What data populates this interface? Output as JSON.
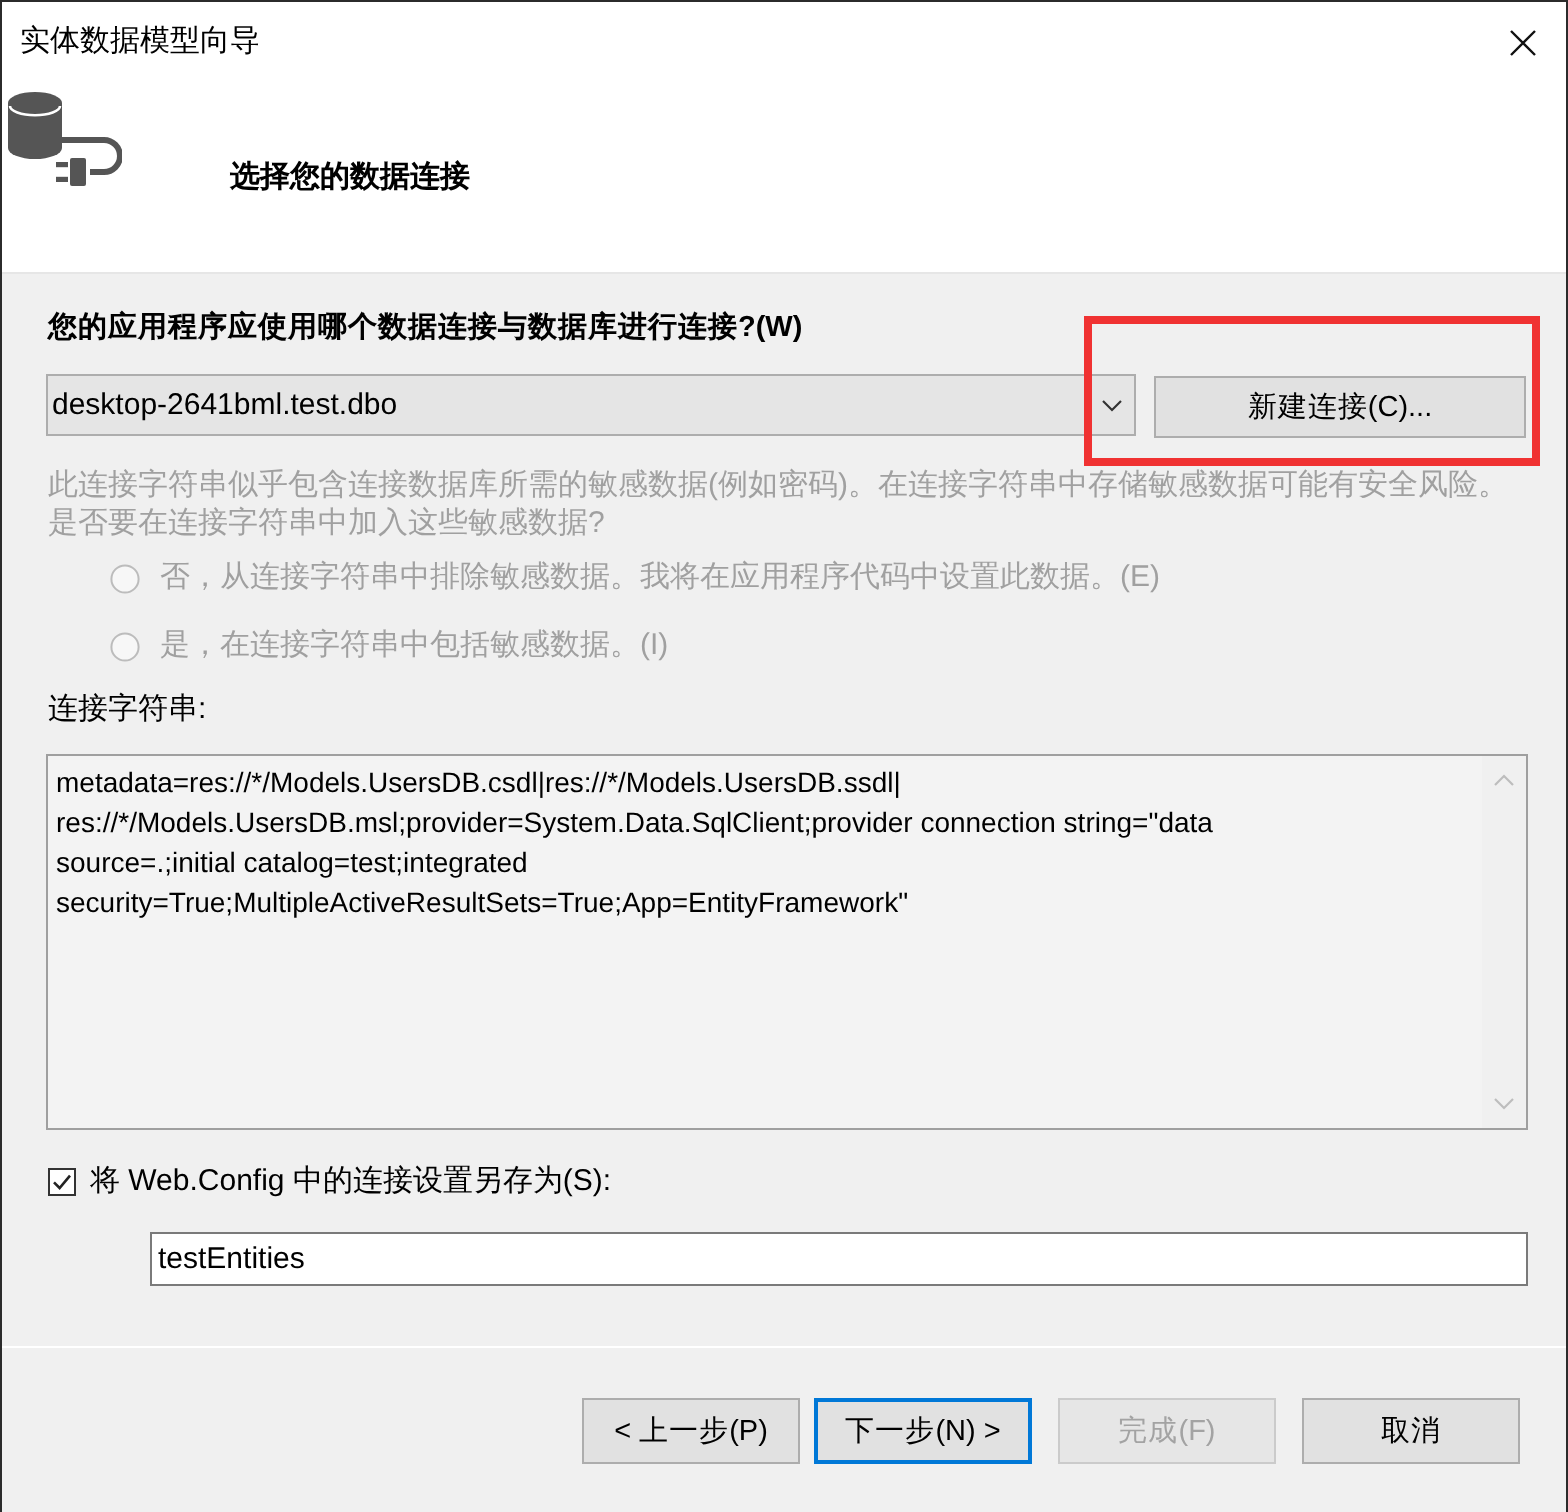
{
  "window": {
    "title": "实体数据模型向导"
  },
  "header": {
    "title": "选择您的数据连接"
  },
  "connection": {
    "label": "您的应用程序应使用哪个数据连接与数据库进行连接?(W)",
    "value": "desktop-2641bml.test.dbo",
    "new_button": {
      "label": "新建连接(C)...",
      "highlighted": true
    }
  },
  "sensitive_data": {
    "disabled": true,
    "text": "此连接字符串似乎包含连接数据库所需的敏感数据(例如密码)。在连接字符串中存储敏感数据可能有安全风险。是否要在连接字符串中加入这些敏感数据?",
    "options": [
      {
        "label": "否，从连接字符串中排除敏感数据。我将在应用程序代码中设置此数据。(E)",
        "selected": false
      },
      {
        "label": "是，在连接字符串中包括敏感数据。(I)",
        "selected": false
      }
    ]
  },
  "connection_string": {
    "label": "连接字符串:",
    "lines": [
      "metadata=res://*/Models.UsersDB.csdl|res://*/Models.UsersDB.ssdl|",
      "res://*/Models.UsersDB.msl;provider=System.Data.SqlClient;provider connection string=\"data",
      "source=.;initial catalog=test;integrated",
      "security=True;MultipleActiveResultSets=True;App=EntityFramework\""
    ]
  },
  "save_setting": {
    "checked": true,
    "label": "将 Web.Config 中的连接设置另存为(S):",
    "value": "testEntities"
  },
  "buttons": [
    {
      "label": "< 上一步(P)",
      "disabled": false,
      "focused": false
    },
    {
      "label": "下一步(N) >",
      "disabled": false,
      "focused": true
    },
    {
      "label": "完成(F)",
      "disabled": true,
      "focused": false
    },
    {
      "label": "取消",
      "disabled": false,
      "focused": false
    }
  ]
}
